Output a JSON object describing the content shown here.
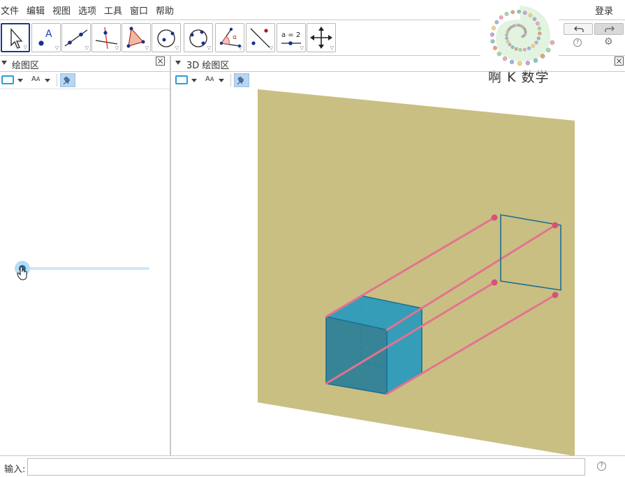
{
  "menu": {
    "items": [
      "文件",
      "编辑",
      "视图",
      "选项",
      "工具",
      "窗口",
      "帮助"
    ],
    "login_label": "登录"
  },
  "toolbar": {
    "tools": [
      {
        "name": "move-tool",
        "icon": "arrow-pointer-icon",
        "active": true
      },
      {
        "name": "point-tool",
        "icon": "point-a-icon",
        "label": "A"
      },
      {
        "name": "line-tool",
        "icon": "line-through-points-icon"
      },
      {
        "name": "perpendicular-line-tool",
        "icon": "perpendicular-line-icon"
      },
      {
        "name": "polygon-tool",
        "icon": "triangle-icon"
      },
      {
        "name": "circle-center-point-tool",
        "icon": "circle-center-icon"
      },
      {
        "name": "circle-three-points-tool",
        "icon": "circle-three-points-icon"
      },
      {
        "name": "angle-tool",
        "icon": "angle-alpha-icon",
        "label": "α"
      },
      {
        "name": "reflect-tool",
        "icon": "reflect-line-icon"
      },
      {
        "name": "slider-tool",
        "icon": "slider-a-equals-2-icon",
        "label": "a = 2"
      },
      {
        "name": "move-graphics-view-tool",
        "icon": "move-arrows-icon"
      }
    ],
    "undo_icon": "undo-icon",
    "redo_icon": "redo-icon",
    "help_icon": "help-icon",
    "help_glyph": "?",
    "settings_icon": "gear-icon",
    "settings_glyph": "⚙"
  },
  "logo": {
    "text": "啊 K 数学",
    "colors": [
      "#a6d9a4",
      "#f2a7b5",
      "#9ab8e8",
      "#f5d37a",
      "#c6a4e0",
      "#86c9c3",
      "#e8a27a"
    ]
  },
  "graphics_panel": {
    "title": "绘图区",
    "style_bar": {
      "aa_label": "A",
      "aa_small": "A"
    }
  },
  "slider": {
    "value_fraction": 0.0
  },
  "view3d_panel": {
    "title": "3D 绘图区",
    "style_bar": {
      "aa_label": "A",
      "aa_small": "A"
    }
  },
  "scene3d": {
    "plane_color": "#c9bf82",
    "cube_front_color": "#2a7f98",
    "cube_side_color": "#2e9bbb",
    "cube_edge_color": "#1a6f94",
    "projection_line_color": "#e3738f",
    "projection_point_color": "#d9507a",
    "projection_square_color": "#1a6f94"
  },
  "input_bar": {
    "label": "输入:",
    "value": "",
    "placeholder": "",
    "help_glyph": "?"
  },
  "colors": {
    "accent": "#1a3a8c",
    "style_blue": "#2a9fd6",
    "pin_bg": "#b8d6f2",
    "slider_track": "#cfe7f7",
    "slider_knob": "#1e6fa3"
  }
}
